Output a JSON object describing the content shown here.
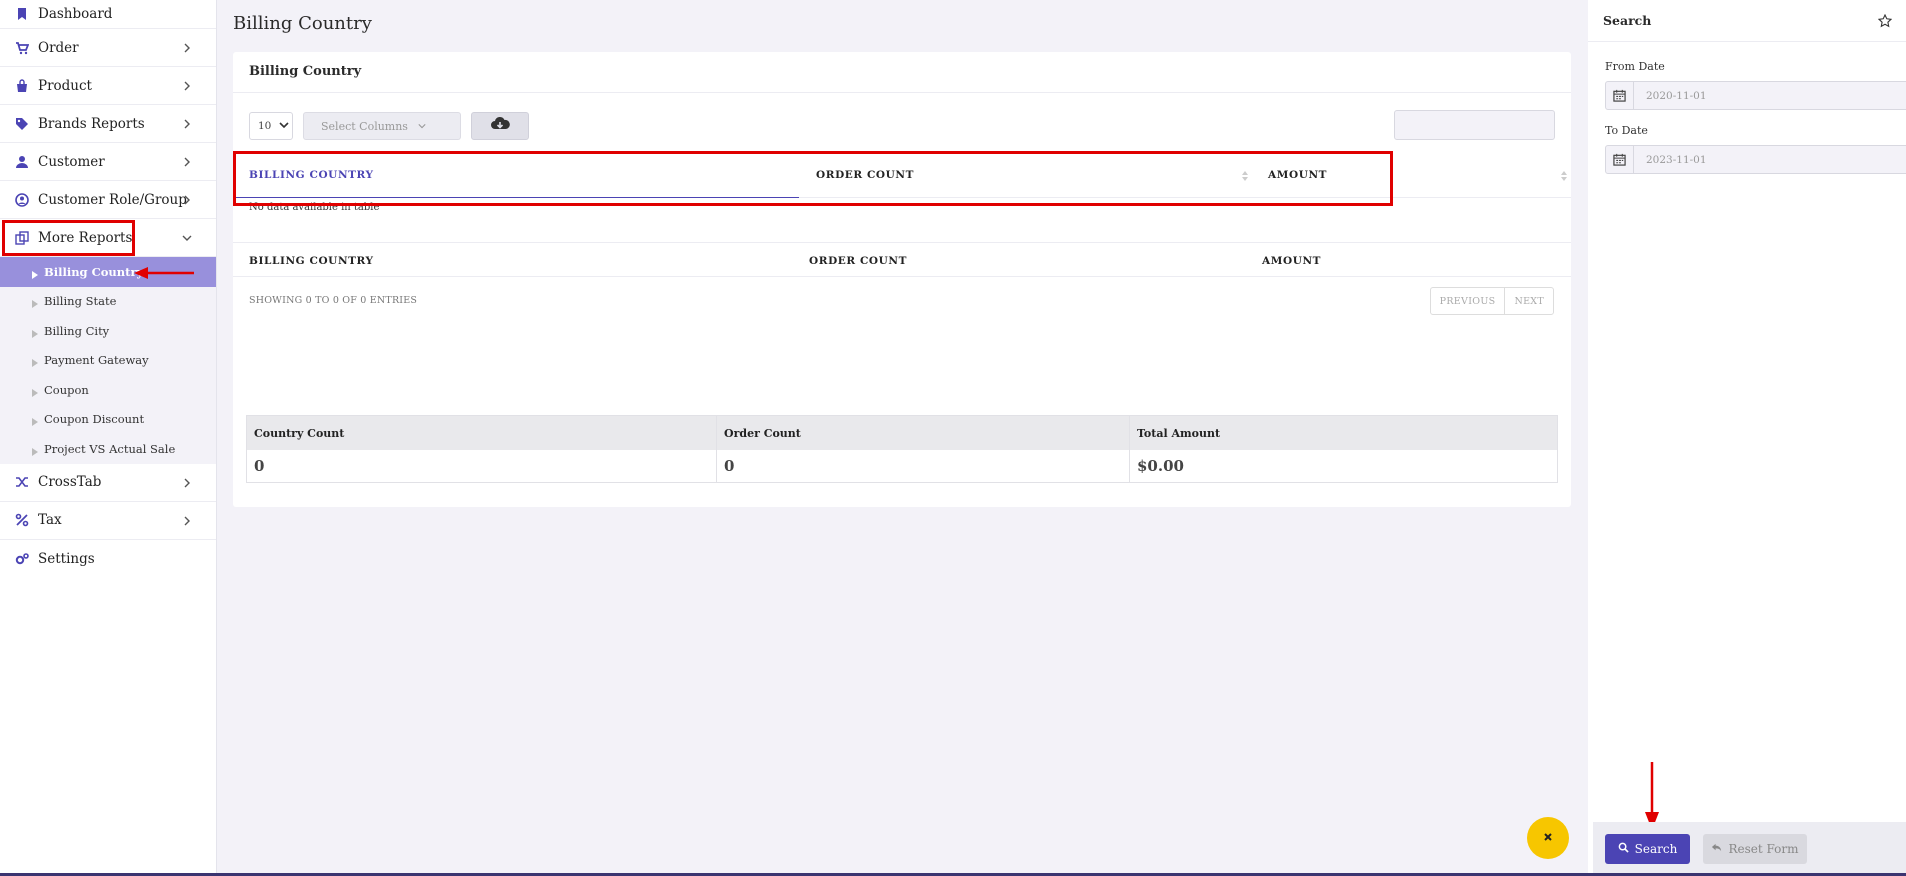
{
  "sidebar": {
    "items": [
      {
        "label": "Dashboard"
      },
      {
        "label": "Order"
      },
      {
        "label": "Product"
      },
      {
        "label": "Brands Reports"
      },
      {
        "label": "Customer"
      },
      {
        "label": "Customer Role/Group"
      },
      {
        "label": "More Reports"
      },
      {
        "label": "CrossTab"
      },
      {
        "label": "Tax"
      },
      {
        "label": "Settings"
      }
    ],
    "sub_items": [
      {
        "label": "Billing Country"
      },
      {
        "label": "Billing State"
      },
      {
        "label": "Billing City"
      },
      {
        "label": "Payment Gateway"
      },
      {
        "label": "Coupon"
      },
      {
        "label": "Coupon Discount"
      },
      {
        "label": "Project VS Actual Sale"
      }
    ]
  },
  "main": {
    "page_title": "Billing Country",
    "card_title": "Billing Country",
    "length_value": "10",
    "columns_placeholder": "Select Columns",
    "table": {
      "headers": [
        "BILLING COUNTRY",
        "ORDER COUNT",
        "AMOUNT"
      ],
      "empty_text": "No data available in table",
      "footers": [
        "BILLING COUNTRY",
        "ORDER COUNT",
        "AMOUNT"
      ]
    },
    "info": "SHOWING 0 TO 0 OF 0 ENTRIES",
    "pager": {
      "previous": "PREVIOUS",
      "next": "NEXT"
    },
    "summary": {
      "headers": [
        "Country Count",
        "Order Count",
        "Total Amount"
      ],
      "values": [
        "0",
        "0",
        "$0.00"
      ]
    }
  },
  "search_panel": {
    "title": "Search",
    "from_label": "From Date",
    "from_value": "2020-11-01",
    "to_label": "To Date",
    "to_value": "2023-11-01",
    "search_button": "Search",
    "reset_button": "Reset Form"
  },
  "colors": {
    "accent": "#4b44b4",
    "active_sub": "#9890dc",
    "highlight": "#e00000",
    "fab": "#f7c600"
  }
}
